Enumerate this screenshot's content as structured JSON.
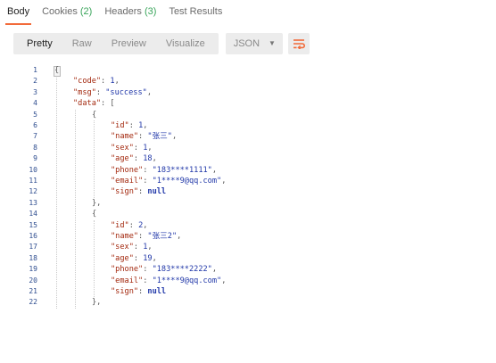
{
  "response_tabs": [
    {
      "label": "Body",
      "count": ""
    },
    {
      "label": "Cookies",
      "count": "(2)"
    },
    {
      "label": "Headers",
      "count": "(3)"
    },
    {
      "label": "Test Results",
      "count": ""
    }
  ],
  "toolbar": {
    "views": [
      "Pretty",
      "Raw",
      "Preview",
      "Visualize"
    ],
    "format": "JSON",
    "wrap_icon": "wrap-lines-icon"
  },
  "code_lines": [
    {
      "n": "1",
      "t": "{"
    },
    {
      "n": "2",
      "t": "\"code\": 1,"
    },
    {
      "n": "3",
      "t": "\"msg\": \"success\","
    },
    {
      "n": "4",
      "t": "\"data\": ["
    },
    {
      "n": "5",
      "t": "{"
    },
    {
      "n": "6",
      "t": "\"id\": 1,"
    },
    {
      "n": "7",
      "t": "\"name\": \"张三\","
    },
    {
      "n": "8",
      "t": "\"sex\": 1,"
    },
    {
      "n": "9",
      "t": "\"age\": 18,"
    },
    {
      "n": "10",
      "t": "\"phone\": \"183****1111\","
    },
    {
      "n": "11",
      "t": "\"email\": \"1****9@qq.com\","
    },
    {
      "n": "12",
      "t": "\"sign\": null"
    },
    {
      "n": "13",
      "t": "},"
    },
    {
      "n": "14",
      "t": "{"
    },
    {
      "n": "15",
      "t": "\"id\": 2,"
    },
    {
      "n": "16",
      "t": "\"name\": \"张三2\","
    },
    {
      "n": "17",
      "t": "\"sex\": 1,"
    },
    {
      "n": "18",
      "t": "\"age\": 19,"
    },
    {
      "n": "19",
      "t": "\"phone\": \"183****2222\","
    },
    {
      "n": "20",
      "t": "\"email\": \"1****9@qq.com\","
    },
    {
      "n": "21",
      "t": "\"sign\": null"
    },
    {
      "n": "22",
      "t": "},"
    }
  ]
}
